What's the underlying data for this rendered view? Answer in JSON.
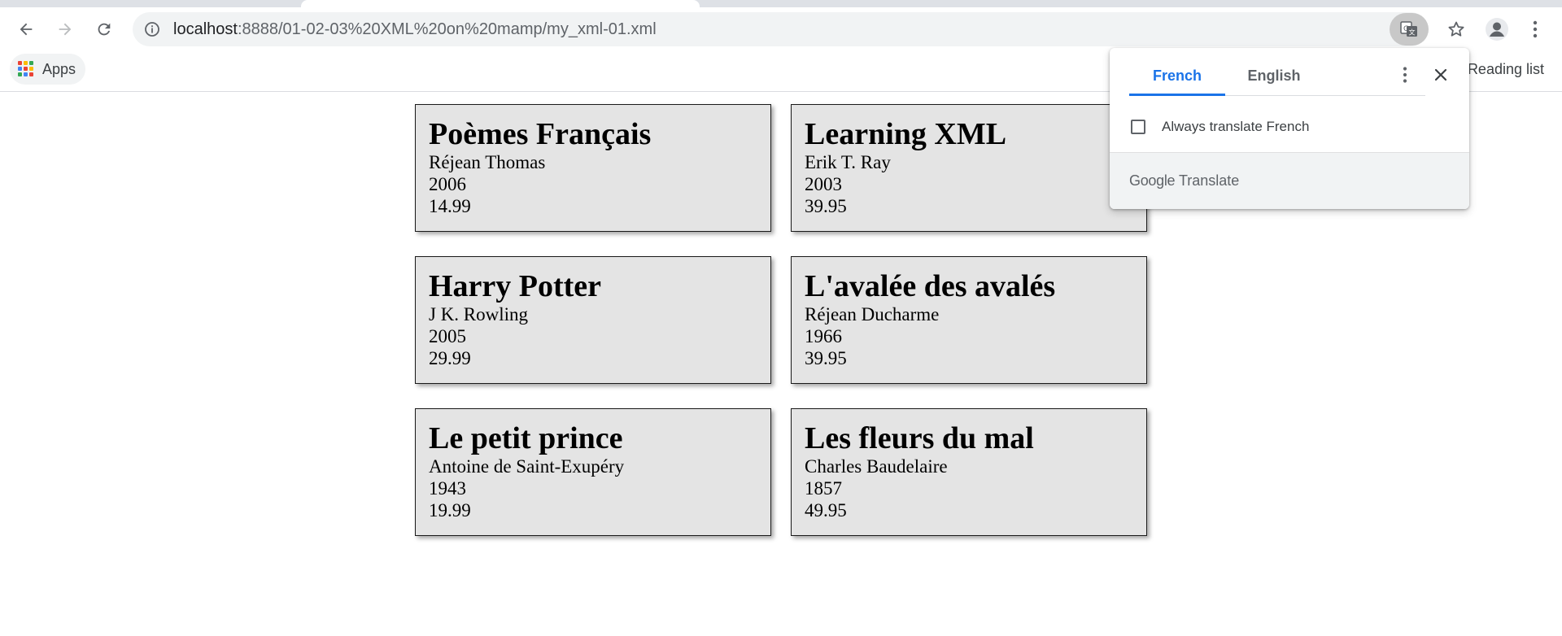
{
  "browser": {
    "url_host": "localhost",
    "url_path": ":8888/01-02-03%20XML%20on%20mamp/my_xml-01.xml",
    "bookmarks": {
      "apps_label": "Apps",
      "reading_list_label": "Reading list"
    }
  },
  "icons": {
    "back": "back-arrow-icon",
    "forward": "forward-arrow-icon",
    "reload": "reload-icon",
    "info": "info-icon",
    "translate": "translate-icon",
    "star": "star-icon",
    "profile": "profile-icon",
    "menu": "kebab-menu-icon",
    "apps": "apps-grid-icon",
    "checkbox": "checkbox-icon",
    "close": "close-icon"
  },
  "books": [
    {
      "title": "Poèmes Français",
      "author": "Réjean Thomas",
      "year": "2006",
      "price": "14.99"
    },
    {
      "title": "Learning XML",
      "author": "Erik T. Ray",
      "year": "2003",
      "price": "39.95"
    },
    {
      "title": "Harry Potter",
      "author": "J K. Rowling",
      "year": "2005",
      "price": "29.99"
    },
    {
      "title": "L'avalée des avalés",
      "author": "Réjean Ducharme",
      "year": "1966",
      "price": "39.95"
    },
    {
      "title": "Le petit prince",
      "author": "Antoine de Saint-Exupéry",
      "year": "1943",
      "price": "19.99"
    },
    {
      "title": "Les fleurs du mal",
      "author": "Charles Baudelaire",
      "year": "1857",
      "price": "49.95"
    }
  ],
  "translate_popup": {
    "tab_source": "French",
    "tab_target": "English",
    "always_translate_label": "Always translate French",
    "always_translate_checked": false,
    "brand_google": "Google",
    "brand_translate": "Translate"
  },
  "colors": {
    "accent": "#1a73e8",
    "card_bg": "#e4e4e4",
    "omnibox_bg": "#f1f3f4"
  }
}
